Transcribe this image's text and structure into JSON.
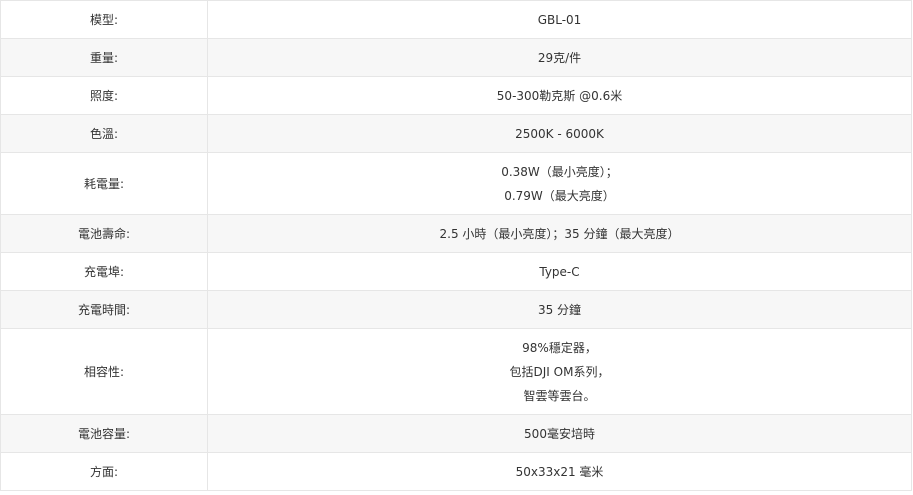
{
  "colors": {
    "row_alt": "#f7f7f7",
    "border": "#e6e6e6",
    "text": "#333333"
  },
  "rows": [
    {
      "label": "模型:",
      "lines": [
        "GBL-01"
      ]
    },
    {
      "label": "重量:",
      "lines": [
        "29克/件"
      ]
    },
    {
      "label": "照度:",
      "lines": [
        "50-300勒克斯 @0.6米"
      ]
    },
    {
      "label": "色溫:",
      "lines": [
        "2500K - 6000K"
      ]
    },
    {
      "label": "耗電量:",
      "lines": [
        "0.38W（最小亮度）；",
        "0.79W（最大亮度）"
      ]
    },
    {
      "label": "電池壽命:",
      "lines": [
        "2.5 小時（最小亮度）；35 分鐘（最大亮度）"
      ]
    },
    {
      "label": "充電埠:",
      "lines": [
        "Type-C"
      ]
    },
    {
      "label": "充電時間:",
      "lines": [
        "35 分鐘"
      ]
    },
    {
      "label": "相容性:",
      "lines": [
        "98%穩定器，",
        "包括DJI OM系列，",
        "智雲等雲台。"
      ]
    },
    {
      "label": "電池容量:",
      "lines": [
        "500毫安培時"
      ]
    },
    {
      "label": "方面:",
      "lines": [
        "50x33x21 毫米"
      ]
    }
  ]
}
